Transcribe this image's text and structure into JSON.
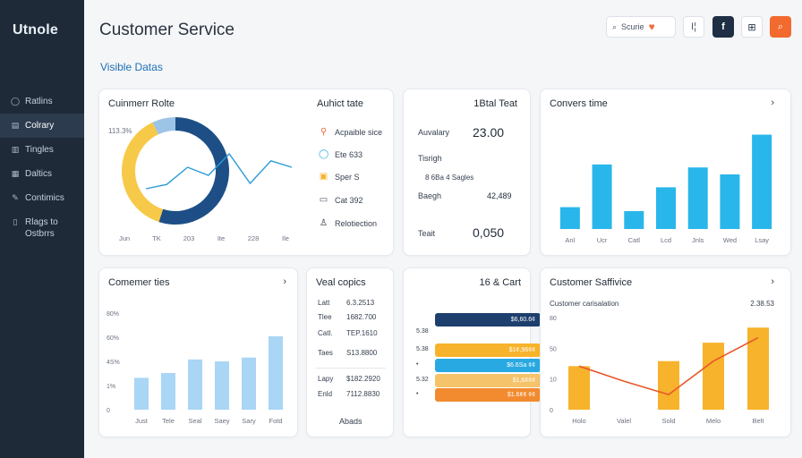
{
  "brand": "Utnole",
  "page_title": "Customer Service",
  "section_label": "Visible Datas",
  "search": {
    "label": "Scurie"
  },
  "toolbar": {
    "btn1": "I¦",
    "btn2": "f",
    "btn3": "⊞",
    "btn4": "⌕"
  },
  "sidebar": {
    "items": [
      {
        "label": "Ratlins",
        "icon": "circle-icon"
      },
      {
        "label": "Colrary",
        "icon": "doc-icon"
      },
      {
        "label": "Tingles",
        "icon": "book-icon"
      },
      {
        "label": "Daltics",
        "icon": "chart-icon"
      },
      {
        "label": "Contimics",
        "icon": "pen-icon"
      },
      {
        "label": "Rlags to Ostbrrs",
        "icon": "page-icon"
      }
    ]
  },
  "card1": {
    "title": "Cuinmerr Rolte",
    "donut_label": "113.3%",
    "x_labels": [
      "Jun",
      "TK",
      "203",
      "Ite",
      "228",
      "Ile"
    ],
    "right_title": "Auhict tate",
    "items": [
      {
        "label": "Acpaible sice"
      },
      {
        "label": "Ete 633"
      },
      {
        "label": "Sper S"
      },
      {
        "label": "Cat 392"
      },
      {
        "label": "Relotiection"
      }
    ]
  },
  "card2": {
    "title": "1Btal Teat",
    "rows": [
      {
        "label": "Auvalary",
        "value": "23.00"
      },
      {
        "label": "Tisrigh",
        "value": ""
      },
      {
        "label": "Baegh",
        "value": "42,489"
      },
      {
        "label": "Teait",
        "value": "0,050"
      }
    ],
    "sub_line": "8 6Ba 4 Sagles"
  },
  "card3": {
    "title": "Convers time"
  },
  "card4": {
    "title": "Comemer ties"
  },
  "card5": {
    "title": "Veal copics",
    "rows": [
      {
        "label": "Latt",
        "value": "6.3.2513"
      },
      {
        "label": "Tlee",
        "value": "1682.700"
      },
      {
        "label": "Catl.",
        "value": "TEP.1610"
      },
      {
        "label": "Taes",
        "value": "S13.8800"
      },
      {
        "label": "Lapy",
        "value": "$182.2920"
      },
      {
        "label": "Enld",
        "value": "7112.8830"
      }
    ],
    "footer": "Abads"
  },
  "card6": {
    "title": "16 & Cart",
    "bars": [
      {
        "side_label": "",
        "text": "$6,60.6¢",
        "pct": 0.82,
        "color": "#1d3f6e"
      },
      {
        "side_label": "5.38",
        "text": "",
        "pct": 0.0,
        "color": "#ffffff"
      },
      {
        "side_label": "5.38",
        "text": "$1¢,96¢¢",
        "pct": 0.82,
        "color": "#f7b32b"
      },
      {
        "side_label": "•",
        "text": "$6.6Sa ¢¢",
        "pct": 0.82,
        "color": "#29a9e1"
      },
      {
        "side_label": "5.32",
        "text": "$1,6¢¢¢",
        "pct": 0.82,
        "color": "#f5c46a"
      },
      {
        "side_label": "•",
        "text": "$1.6¢¢ ¢¢",
        "pct": 0.82,
        "color": "#f28b30"
      }
    ]
  },
  "card7": {
    "title": "Customer Saffivice",
    "subtitle": "Customer carisalation",
    "subvalue": "2.38.53"
  },
  "chart_data": [
    {
      "type": "bar",
      "title": "Convers time",
      "categories": [
        "Anl",
        "Ucr",
        "Catl",
        "Lcd",
        "Jnls",
        "Wed",
        "Lsay"
      ],
      "values": [
        22,
        65,
        18,
        42,
        62,
        55,
        95
      ],
      "ylim": [
        0,
        100
      ],
      "colors": {
        "bar": "#29b6ea"
      }
    },
    {
      "type": "bar",
      "title": "Comemer ties",
      "categories": [
        "Just",
        "Tele",
        "Seal",
        "Saey",
        "Sary",
        "Fotd"
      ],
      "values": [
        33,
        38,
        52,
        50,
        54,
        76
      ],
      "yticks": [
        "0",
        "1%",
        "4S%",
        "60%",
        "80%"
      ],
      "ylim": [
        0,
        100
      ],
      "colors": {
        "bar": "#a9d6f5"
      }
    },
    {
      "type": "bar",
      "title": "Customer Saffivice",
      "categories": [
        "Holo",
        "Valel",
        "Sold",
        "Melo",
        "Belt"
      ],
      "values": [
        52,
        0,
        58,
        80,
        98
      ],
      "line_values": [
        52,
        34,
        18,
        58,
        86
      ],
      "yticks": [
        "0",
        "10",
        "50",
        "80"
      ],
      "ylim": [
        0,
        110
      ],
      "colors": {
        "bar": "#f7b32b",
        "line": "#e8582b"
      }
    },
    {
      "type": "pie",
      "title": "Cuinmerr Rolte",
      "slices": [
        {
          "name": "dark",
          "value": 55,
          "color": "#1d4f86"
        },
        {
          "name": "yellow",
          "value": 38,
          "color": "#f7c948"
        },
        {
          "name": "light",
          "value": 7,
          "color": "#9cc4e6"
        }
      ],
      "line_values": [
        20,
        28,
        60,
        45,
        85,
        30,
        72,
        60
      ],
      "colors": {
        "line": "#2a9bd6"
      }
    }
  ]
}
